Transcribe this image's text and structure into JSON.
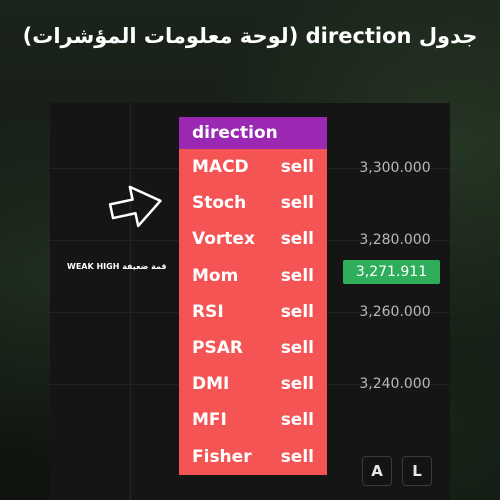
{
  "title": "جدول direction (لوحة معلومات المؤشرات)",
  "chart": {
    "price_labels": [
      "3,300.000",
      "3,280.000",
      "3,260.000",
      "3,240.000"
    ],
    "current_price": "3,271.911",
    "current_price_color": "#2eae5a",
    "annotation": "WEAK HIGH قمة ضعيفة",
    "buttons": [
      "A",
      "L"
    ]
  },
  "table": {
    "header": "direction",
    "header_color": "#9b28b3",
    "body_color": "#f45454",
    "rows": [
      {
        "indicator": "MACD",
        "signal": "sell"
      },
      {
        "indicator": "Stoch",
        "signal": "sell"
      },
      {
        "indicator": "Vortex",
        "signal": "sell"
      },
      {
        "indicator": "Mom",
        "signal": "sell"
      },
      {
        "indicator": "RSI",
        "signal": "sell"
      },
      {
        "indicator": "PSAR",
        "signal": "sell"
      },
      {
        "indicator": "DMI",
        "signal": "sell"
      },
      {
        "indicator": "MFI",
        "signal": "sell"
      },
      {
        "indicator": "Fisher",
        "signal": "sell"
      }
    ]
  }
}
